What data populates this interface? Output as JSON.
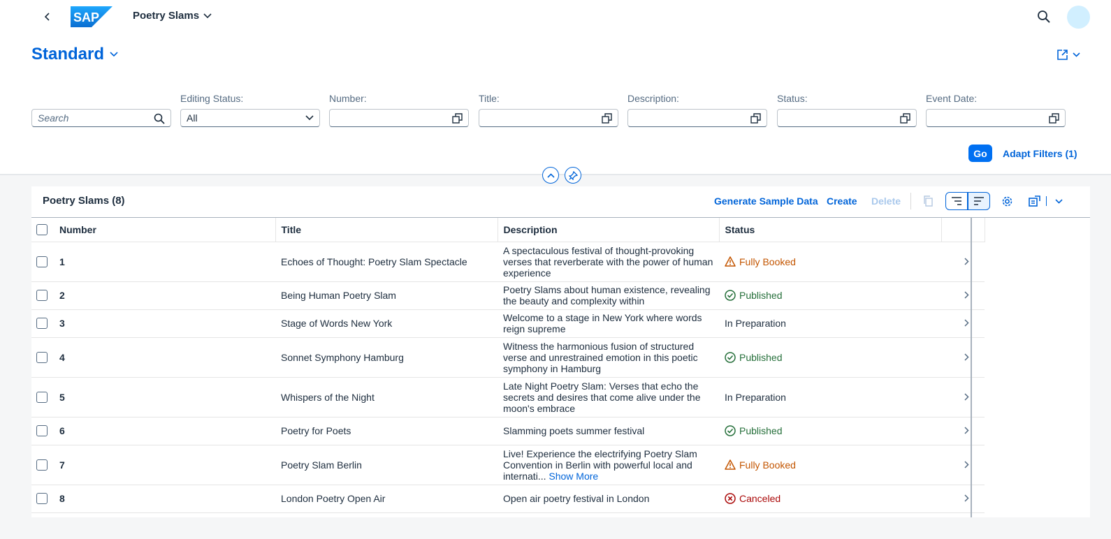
{
  "shell": {
    "app_title": "Poetry Slams"
  },
  "header": {
    "variant_name": "Standard"
  },
  "filters": {
    "search": {
      "placeholder": "Search"
    },
    "editing_status": {
      "label": "Editing Status:",
      "value": "All"
    },
    "number": {
      "label": "Number:"
    },
    "title": {
      "label": "Title:"
    },
    "description": {
      "label": "Description:"
    },
    "status": {
      "label": "Status:"
    },
    "event_date": {
      "label": "Event Date:"
    },
    "go_label": "Go",
    "adapt_label": "Adapt Filters (1)"
  },
  "table": {
    "title": "Poetry Slams (8)",
    "actions": {
      "generate": "Generate Sample Data",
      "create": "Create",
      "delete": "Delete"
    },
    "columns": [
      "Number",
      "Title",
      "Description",
      "Status"
    ],
    "rows": [
      {
        "number": "1",
        "title": "Echoes of Thought: Poetry Slam Spectacle",
        "description": "A spectaculous festival of thought-provoking verses that reverberate with the power of human experience",
        "status": "Fully Booked",
        "status_type": "booked"
      },
      {
        "number": "2",
        "title": "Being Human Poetry Slam",
        "description": "Poetry Slams about human existence, revealing the beauty and complexity within",
        "status": "Published",
        "status_type": "published"
      },
      {
        "number": "3",
        "title": "Stage of Words New York",
        "description": "Welcome to a stage in New York where words reign supreme",
        "status": "In Preparation",
        "status_type": "prep"
      },
      {
        "number": "4",
        "title": "Sonnet Symphony Hamburg",
        "description": "Witness the harmonious fusion of structured verse and unrestrained emotion in this poetic symphony in Hamburg",
        "status": "Published",
        "status_type": "published"
      },
      {
        "number": "5",
        "title": "Whispers of the Night",
        "description": "Late Night Poetry Slam: Verses that echo the secrets and desires that come alive under the moon's embrace",
        "status": "In Preparation",
        "status_type": "prep"
      },
      {
        "number": "6",
        "title": "Poetry for Poets",
        "description": "Slamming poets summer festival",
        "status": "Published",
        "status_type": "published"
      },
      {
        "number": "7",
        "title": "Poetry Slam Berlin",
        "description": "Live! Experience the electrifying Poetry Slam Convention in Berlin with powerful local and internati...",
        "description_more": "Show More",
        "status": "Fully Booked",
        "status_type": "booked"
      },
      {
        "number": "8",
        "title": "London Poetry Open Air",
        "description": "Open air poetry festival in London",
        "status": "Canceled",
        "status_type": "canceled"
      }
    ]
  },
  "colors": {
    "brand": "#0064d9",
    "go": "#0070f2",
    "warning": "#c35500",
    "success": "#256f3a",
    "error": "#aa0808"
  }
}
